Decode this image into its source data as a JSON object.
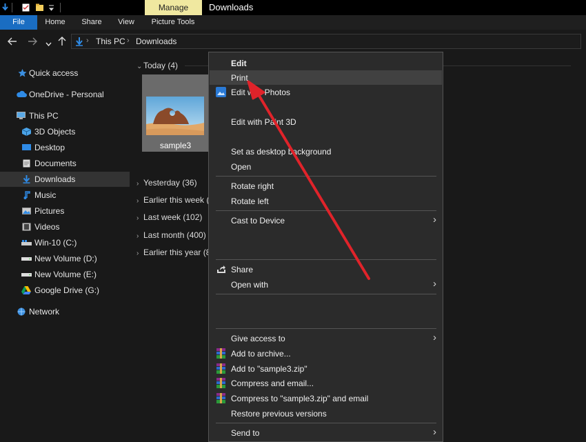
{
  "window": {
    "title": "Downloads",
    "contextual_tab": "Manage"
  },
  "ribbon": {
    "tabs": [
      {
        "label": "File"
      },
      {
        "label": "Home"
      },
      {
        "label": "Share"
      },
      {
        "label": "View"
      },
      {
        "label": "Picture Tools"
      }
    ]
  },
  "address": {
    "crumbs": [
      "This PC",
      "Downloads"
    ]
  },
  "sidebar": {
    "items": [
      {
        "label": "Quick access",
        "icon": "star-icon"
      },
      {
        "label": "OneDrive - Personal",
        "icon": "cloud-icon"
      },
      {
        "label": "This PC",
        "icon": "computer-icon"
      },
      {
        "label": "3D Objects",
        "icon": "cube-icon"
      },
      {
        "label": "Desktop",
        "icon": "desktop-icon"
      },
      {
        "label": "Documents",
        "icon": "document-icon"
      },
      {
        "label": "Downloads",
        "icon": "download-icon"
      },
      {
        "label": "Music",
        "icon": "music-icon"
      },
      {
        "label": "Pictures",
        "icon": "pictures-icon"
      },
      {
        "label": "Videos",
        "icon": "videos-icon"
      },
      {
        "label": "Win-10 (C:)",
        "icon": "drive-icon"
      },
      {
        "label": "New Volume (D:)",
        "icon": "drive-icon"
      },
      {
        "label": "New Volume (E:)",
        "icon": "drive-icon"
      },
      {
        "label": "Google Drive (G:)",
        "icon": "google-drive-icon"
      },
      {
        "label": "Network",
        "icon": "network-icon"
      }
    ]
  },
  "groups": [
    {
      "label": "Today (4)"
    },
    {
      "label": "Yesterday (36)"
    },
    {
      "label": "Earlier this week ("
    },
    {
      "label": "Last week (102)"
    },
    {
      "label": "Last month (400)"
    },
    {
      "label": "Earlier this year (8"
    }
  ],
  "file": {
    "name": "sample3"
  },
  "context_menu": {
    "items": [
      {
        "label": "Edit"
      },
      {
        "label": "Print"
      },
      {
        "label": "Edit with Photos"
      },
      {
        "label": "Edit with Paint 3D"
      },
      {
        "label": "Set as desktop background"
      },
      {
        "label": "Open"
      },
      {
        "label": "Rotate right"
      },
      {
        "label": "Rotate left"
      },
      {
        "label": "Cast to Device"
      },
      {
        "label": "Share"
      },
      {
        "label": "Open with"
      },
      {
        "label": "Give access to"
      },
      {
        "label": "Add to archive..."
      },
      {
        "label": "Add to \"sample3.zip\""
      },
      {
        "label": "Compress and email..."
      },
      {
        "label": "Compress to \"sample3.zip\" and email"
      },
      {
        "label": "Restore previous versions"
      },
      {
        "label": "Send to"
      }
    ]
  },
  "colors": {
    "accent": "#1a6dc2",
    "highlight": "#414141",
    "annotation_arrow": "#e0232a"
  }
}
